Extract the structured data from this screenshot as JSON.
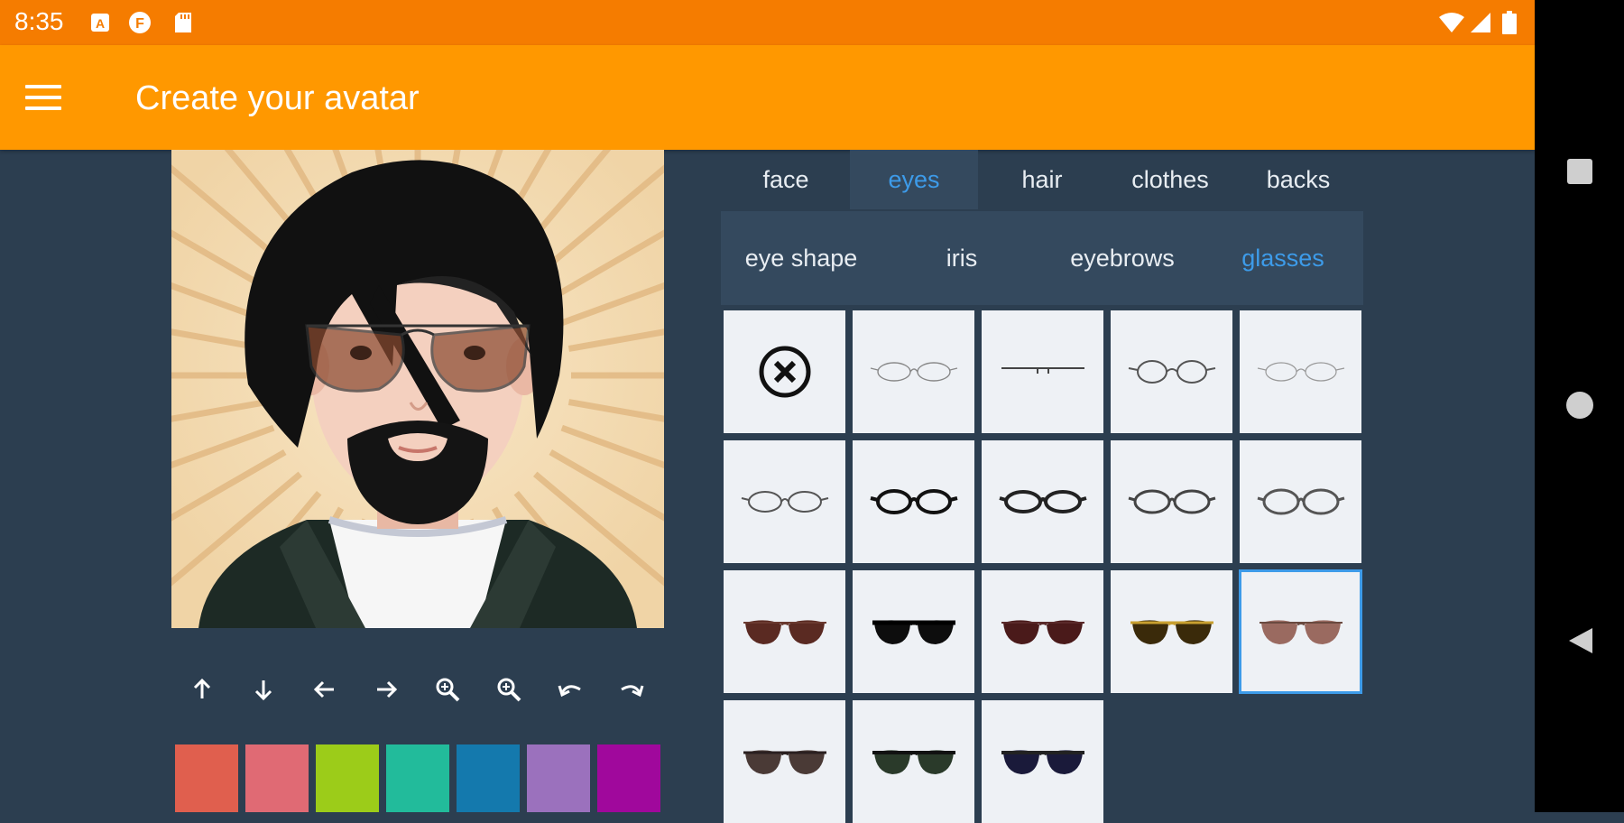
{
  "status_bar": {
    "time": "8:35",
    "left_icons": [
      "notification-a-icon",
      "notification-f-icon",
      "sd-card-icon"
    ],
    "right_icons": [
      "wifi-icon",
      "signal-icon",
      "battery-icon"
    ]
  },
  "app_bar": {
    "menu_icon": "hamburger-menu-icon",
    "title": "Create your avatar"
  },
  "nav_bar": [
    "recents-square-icon",
    "home-circle-icon",
    "back-triangle-icon"
  ],
  "main_tabs": [
    {
      "label": "face",
      "active": false
    },
    {
      "label": "eyes",
      "active": true
    },
    {
      "label": "hair",
      "active": false
    },
    {
      "label": "clothes",
      "active": false
    },
    {
      "label": "backs",
      "active": false
    }
  ],
  "sub_tabs": [
    {
      "label": "eye shape",
      "active": false
    },
    {
      "label": "iris",
      "active": false
    },
    {
      "label": "eyebrows",
      "active": false
    },
    {
      "label": "glasses",
      "active": true
    }
  ],
  "controls": [
    "arrow-up-icon",
    "arrow-down-icon",
    "arrow-left-icon",
    "arrow-right-icon",
    "zoom-in-icon",
    "zoom-out-icon",
    "undo-icon",
    "redo-icon"
  ],
  "colors": {
    "accent": "#3d9be9",
    "app_bar": "#ff9800",
    "status_bar": "#f57c00",
    "background": "#2c3e50"
  },
  "swatches": [
    "#e05f4e",
    "#e06a74",
    "#9ccc19",
    "#22bb9b",
    "#1479ad",
    "#9b71bd",
    "#a0089c"
  ],
  "glasses_options": [
    {
      "icon": "none-x-icon",
      "selected": false
    },
    {
      "icon": "thin-oval-glasses-icon",
      "selected": false
    },
    {
      "icon": "rimless-glasses-icon",
      "selected": false
    },
    {
      "icon": "round-glasses-icon",
      "selected": false
    },
    {
      "icon": "light-oval-glasses-icon",
      "selected": false
    },
    {
      "icon": "oval-glasses-icon",
      "selected": false
    },
    {
      "icon": "black-frame-glasses-icon",
      "selected": false
    },
    {
      "icon": "square-frame-glasses-icon",
      "selected": false
    },
    {
      "icon": "browline-glasses-icon",
      "selected": false
    },
    {
      "icon": "wide-frame-glasses-icon",
      "selected": false
    },
    {
      "icon": "brown-cateye-sunglasses-icon",
      "selected": false
    },
    {
      "icon": "black-wayfarer-sunglasses-icon",
      "selected": false
    },
    {
      "icon": "dark-red-sunglasses-icon",
      "selected": false
    },
    {
      "icon": "gold-sunglasses-icon",
      "selected": false
    },
    {
      "icon": "brown-aviator-sunglasses-icon",
      "selected": true
    },
    {
      "icon": "dark-round-sunglasses-icon",
      "selected": false
    },
    {
      "icon": "green-tint-sunglasses-icon",
      "selected": false
    },
    {
      "icon": "navy-gradient-sunglasses-icon",
      "selected": false
    }
  ]
}
